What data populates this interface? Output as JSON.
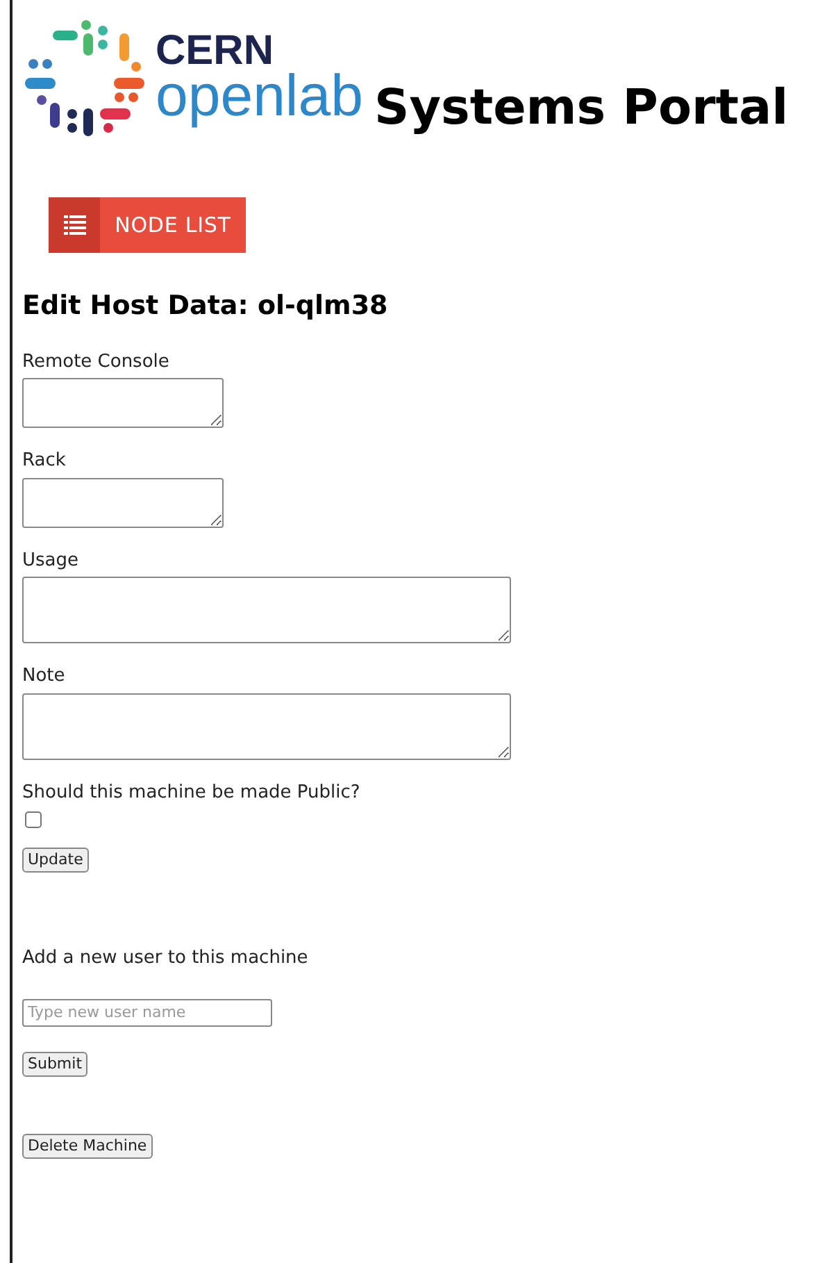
{
  "header": {
    "logo_top": "CERN",
    "logo_bottom": "openlab",
    "title": "Systems Portal"
  },
  "nav_button": {
    "label": "NODE LIST"
  },
  "heading": "Edit Host Data: ol-qlm38",
  "fields": [
    {
      "label": "Remote Console",
      "kind": "short"
    },
    {
      "label": "Rack",
      "kind": "short"
    },
    {
      "label": "Usage",
      "kind": "long"
    },
    {
      "label": "Note",
      "kind": "long"
    }
  ],
  "public": {
    "label": "Should this machine be made Public?",
    "checked": false
  },
  "update_button": "Update",
  "add_user": {
    "label": "Add a new user to this machine",
    "placeholder": "Type new user name",
    "button": "Submit"
  },
  "delete_button": "Delete Machine"
}
